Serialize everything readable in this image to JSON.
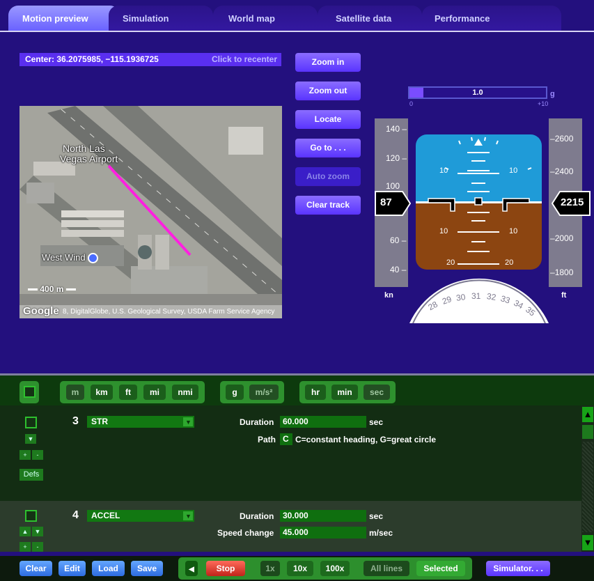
{
  "tabs": [
    {
      "label": "Motion preview"
    },
    {
      "label": "Simulation"
    },
    {
      "label": "World map"
    },
    {
      "label": "Satellite data"
    },
    {
      "label": "Performance"
    }
  ],
  "preview": {
    "center_text": "Center: 36.2075985, −115.1936725",
    "recenter_label": "Click to recenter",
    "map": {
      "airport_label_1": "North Las",
      "airport_label_2": "Vegas Airport",
      "place_label": "West Wind",
      "scale": "400 m",
      "logo": "Google",
      "attribution": "8, DigitalGlobe, U.S. Geological Survey, USDA Farm Service Agency"
    },
    "buttons": {
      "zoom_in": "Zoom in",
      "zoom_out": "Zoom out",
      "locate": "Locate",
      "go_to": "Go to . . .",
      "auto_zoom": "Auto zoom",
      "clear_track": "Clear track"
    }
  },
  "instruments": {
    "g_meter": {
      "value": "1.0",
      "unit": "g",
      "min": "0",
      "max": "+10",
      "fill": 0.1
    },
    "speed": {
      "ticks": [
        "140",
        "120",
        "100",
        "60",
        "40"
      ],
      "current": "87",
      "unit": "kn"
    },
    "altitude": {
      "ticks": [
        "2600",
        "2400",
        "2000",
        "1800"
      ],
      "current": "2215",
      "unit": "ft"
    },
    "pitch_labels": {
      "up": "10",
      "down10": "10",
      "down20": "20"
    },
    "heading_labels": [
      "28",
      "29",
      "30",
      "31",
      "32",
      "33",
      "34",
      "35"
    ]
  },
  "units": {
    "distance": [
      "m",
      "km",
      "ft",
      "mi",
      "nmi"
    ],
    "accel": [
      "g",
      "m/s²"
    ],
    "time": [
      "hr",
      "min",
      "sec"
    ]
  },
  "segments": [
    {
      "number": "3",
      "type": "STR",
      "duration_label": "Duration",
      "duration_value": "60.000",
      "duration_unit": "sec",
      "path_label": "Path",
      "path_value": "C",
      "path_hint": "C=constant heading, G=great circle",
      "defs_label": "Defs",
      "plus": "+",
      "minus": "-"
    },
    {
      "number": "4",
      "type": "ACCEL",
      "duration_label": "Duration",
      "duration_value": "30.000",
      "duration_unit": "sec",
      "speed_label": "Speed change",
      "speed_value": "45.000",
      "speed_unit": "m/sec",
      "plus": "+",
      "minus": "-"
    }
  ],
  "bottom": {
    "clear": "Clear",
    "edit": "Edit",
    "load": "Load",
    "save": "Save",
    "stop": "Stop",
    "speed_1x": "1x",
    "speed_10x": "10x",
    "speed_100x": "100x",
    "all_lines": "All lines",
    "selected": "Selected",
    "simulator": "Simulator. . ."
  }
}
